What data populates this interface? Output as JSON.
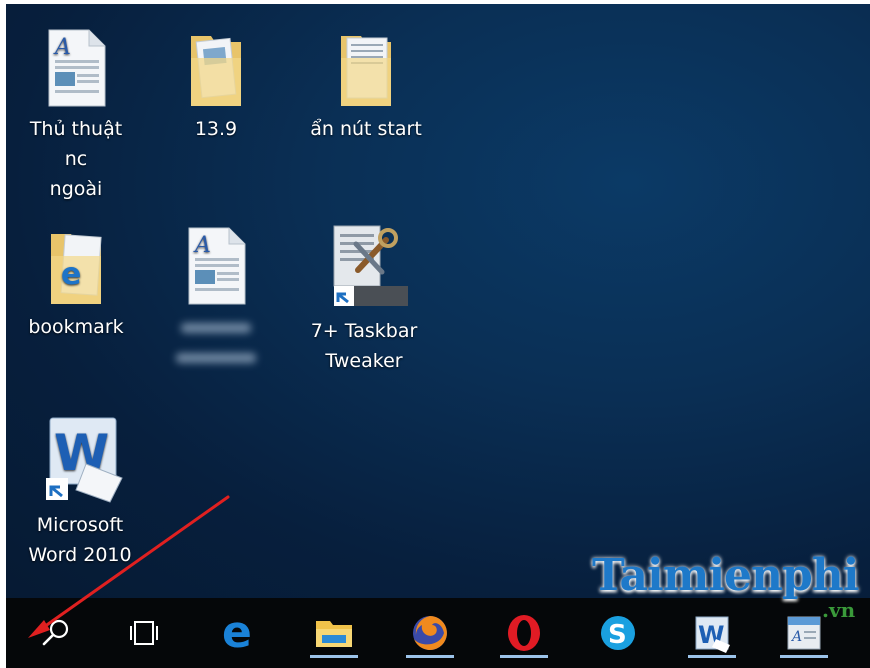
{
  "desktop": {
    "icons": [
      {
        "label_line1": "Thủ thuật nc",
        "label_line2": "ngoài",
        "type": "document"
      },
      {
        "label_line1": "13.9",
        "label_line2": "",
        "type": "folder"
      },
      {
        "label_line1": "ẩn nút start",
        "label_line2": "",
        "type": "folder"
      },
      {
        "label_line1": "bookmark",
        "label_line2": "",
        "type": "folder-ie"
      },
      {
        "label_line1": "",
        "label_line2": "",
        "type": "document-blurred"
      },
      {
        "label_line1": "7+ Taskbar",
        "label_line2": "Tweaker",
        "type": "app-shortcut"
      },
      {
        "label_line1": "Microsoft",
        "label_line2": "Word 2010",
        "type": "word-shortcut"
      }
    ]
  },
  "taskbar": {
    "items": [
      {
        "name": "search-icon"
      },
      {
        "name": "task-view-icon"
      },
      {
        "name": "edge-icon"
      },
      {
        "name": "file-explorer-icon"
      },
      {
        "name": "firefox-icon"
      },
      {
        "name": "opera-icon"
      },
      {
        "name": "skype-icon"
      },
      {
        "name": "word-icon"
      },
      {
        "name": "wordpad-icon"
      }
    ]
  },
  "watermark": {
    "brand": "Taimienphi",
    "suffix": ".vn"
  },
  "colors": {
    "accent": "#1e79c9",
    "arrow": "#e02020",
    "taskbar": "#050709"
  }
}
